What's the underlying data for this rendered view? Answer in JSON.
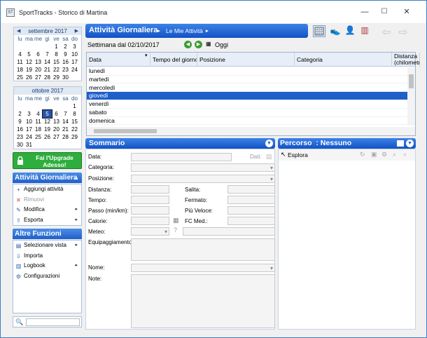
{
  "window": {
    "title": "SportTracks - Storico di Martina",
    "minimize": "—",
    "maximize": "☐",
    "close": "✕"
  },
  "calendar1": {
    "month": "settembre 2017",
    "dow": [
      "lu",
      "ma",
      "me",
      "gi",
      "ve",
      "sa",
      "do"
    ],
    "weeks": [
      [
        "",
        "",
        "",
        "",
        "1",
        "2",
        "3"
      ],
      [
        "4",
        "5",
        "6",
        "7",
        "8",
        "9",
        "10"
      ],
      [
        "11",
        "12",
        "13",
        "14",
        "15",
        "16",
        "17"
      ],
      [
        "18",
        "19",
        "20",
        "21",
        "22",
        "23",
        "24"
      ],
      [
        "25",
        "26",
        "27",
        "28",
        "29",
        "30",
        ""
      ]
    ]
  },
  "calendar2": {
    "month": "ottobre 2017",
    "dow": [
      "lu",
      "ma",
      "me",
      "gi",
      "ve",
      "sa",
      "do"
    ],
    "weeks": [
      [
        "",
        "",
        "",
        "",
        "",
        "",
        "1"
      ],
      [
        "2",
        "3",
        "4",
        "5",
        "6",
        "7",
        "8"
      ],
      [
        "9",
        "10",
        "11",
        "12",
        "13",
        "14",
        "15"
      ],
      [
        "16",
        "17",
        "18",
        "19",
        "20",
        "21",
        "22"
      ],
      [
        "23",
        "24",
        "25",
        "26",
        "27",
        "28",
        "29"
      ],
      [
        "30",
        "31",
        "",
        "",
        "",
        "",
        ""
      ]
    ],
    "today": "5"
  },
  "upgrade": {
    "label": "Fai l'Upgrade Adesso!"
  },
  "sidebar": {
    "daily": {
      "title": "Attività Giornaliera",
      "items": [
        {
          "label": "Aggiungi attività",
          "icon": "+"
        },
        {
          "label": "Rimuovi",
          "icon": "✖"
        },
        {
          "label": "Modifica",
          "icon": "✎"
        },
        {
          "label": "Esporta",
          "icon": "⇪"
        }
      ]
    },
    "other": {
      "title": "Altre Funzioni",
      "items": [
        {
          "label": "Selezionare vista",
          "icon": "▤"
        },
        {
          "label": "Importa",
          "icon": "⇩"
        },
        {
          "label": "Logbook",
          "icon": "▥"
        },
        {
          "label": "Configurazioni",
          "icon": "⚙"
        }
      ]
    },
    "search_placeholder": ""
  },
  "main": {
    "title": "Attività Giornaliera",
    "breadcrumb": "Le Mie Attività",
    "week_label": "Settimana dal 02/10/2017",
    "today_label": "Oggi"
  },
  "table": {
    "columns": [
      "Data",
      "Tempo del giorno",
      "Posizione",
      "Categoria",
      "Distanza (chilometri)"
    ],
    "rows": [
      "lunedì",
      "martedì",
      "mercoledì",
      "giovedì",
      "venerdì",
      "sabato",
      "domenica"
    ],
    "selected": "giovedì"
  },
  "summary": {
    "title": "Sommario",
    "labels": {
      "data": "Data:",
      "dati": "Dati:",
      "categoria": "Categoria:",
      "posizione": "Posizione:",
      "distanza": "Distanza:",
      "salita": "Salita:",
      "tempo": "Tempo:",
      "fermato": "Fermato:",
      "passo": "Passo (min/km):",
      "piuveloce": "Più Veloce:",
      "calorie": "Calorie:",
      "fcmed": "FC Med.:",
      "meteo": "Meteo:",
      "equip": "Equipaggiamento",
      "nome": "Nome:",
      "note": "Note:"
    }
  },
  "route": {
    "title": "Percorso  : Nessuno",
    "explore": "Esplora"
  }
}
